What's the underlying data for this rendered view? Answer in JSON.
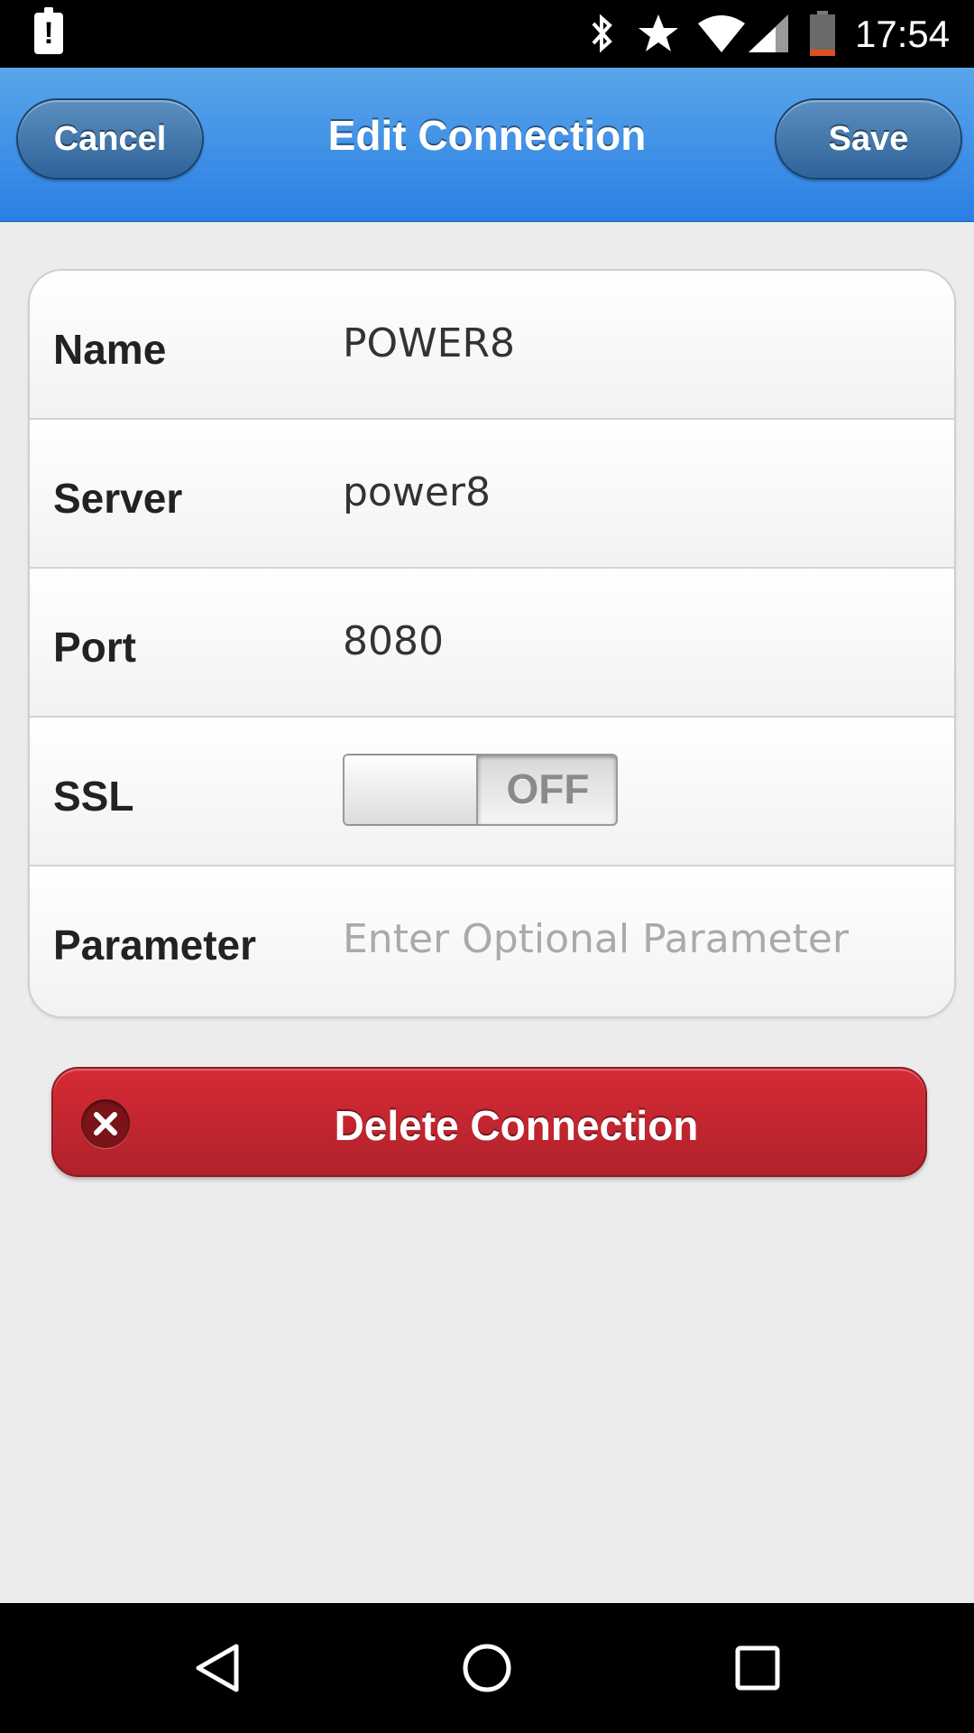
{
  "status_bar": {
    "time": "17:54",
    "notification_glyph": "!",
    "icons": [
      "alert-icon",
      "bluetooth-icon",
      "star-icon",
      "wifi-icon",
      "signal-icon",
      "battery-icon"
    ]
  },
  "header": {
    "title": "Edit Connection",
    "cancel_label": "Cancel",
    "save_label": "Save"
  },
  "form": {
    "rows": [
      {
        "label": "Name",
        "value": "POWER8",
        "placeholder": ""
      },
      {
        "label": "Server",
        "value": "power8",
        "placeholder": ""
      },
      {
        "label": "Port",
        "value": "8080",
        "placeholder": ""
      },
      {
        "label": "SSL",
        "toggle_state": "OFF"
      },
      {
        "label": "Parameter",
        "value": "",
        "placeholder": "Enter Optional Parameter"
      }
    ]
  },
  "delete_button": {
    "label": "Delete Connection",
    "icon": "close-circle-icon"
  },
  "nav_bar": {
    "buttons": [
      "back-icon",
      "home-icon",
      "recent-apps-icon"
    ]
  },
  "colors": {
    "header_blue": "#2a7fe3",
    "delete_red": "#c4252f"
  }
}
